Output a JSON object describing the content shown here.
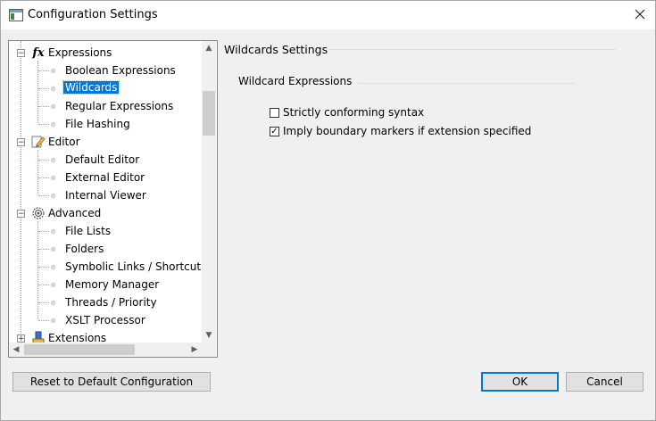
{
  "window": {
    "title": "Configuration Settings"
  },
  "tree": {
    "groups": [
      {
        "label": "Expressions",
        "icon": "fx-icon",
        "children": [
          {
            "label": "Boolean Expressions"
          },
          {
            "label": "Wildcards",
            "selected": true
          },
          {
            "label": "Regular Expressions"
          },
          {
            "label": "File Hashing"
          }
        ]
      },
      {
        "label": "Editor",
        "icon": "pencil-document-icon",
        "children": [
          {
            "label": "Default Editor"
          },
          {
            "label": "External Editor"
          },
          {
            "label": "Internal Viewer"
          }
        ]
      },
      {
        "label": "Advanced",
        "icon": "gear-icon",
        "children": [
          {
            "label": "File Lists"
          },
          {
            "label": "Folders"
          },
          {
            "label": "Symbolic Links / Shortcut"
          },
          {
            "label": "Memory Manager"
          },
          {
            "label": "Threads / Priority"
          },
          {
            "label": "XSLT Processor"
          }
        ]
      },
      {
        "label": "Extensions",
        "icon": "extensions-icon",
        "children": []
      }
    ]
  },
  "panel": {
    "title": "Wildcards Settings",
    "group_title": "Wildcard Expressions",
    "options": [
      {
        "label": "Strictly conforming syntax",
        "checked": false
      },
      {
        "label": "Imply boundary markers if extension specified",
        "checked": true
      }
    ]
  },
  "buttons": {
    "reset": "Reset to Default Configuration",
    "ok": "OK",
    "cancel": "Cancel"
  },
  "colors": {
    "selection": "#0078d7",
    "accent_border": "#0078d7"
  }
}
